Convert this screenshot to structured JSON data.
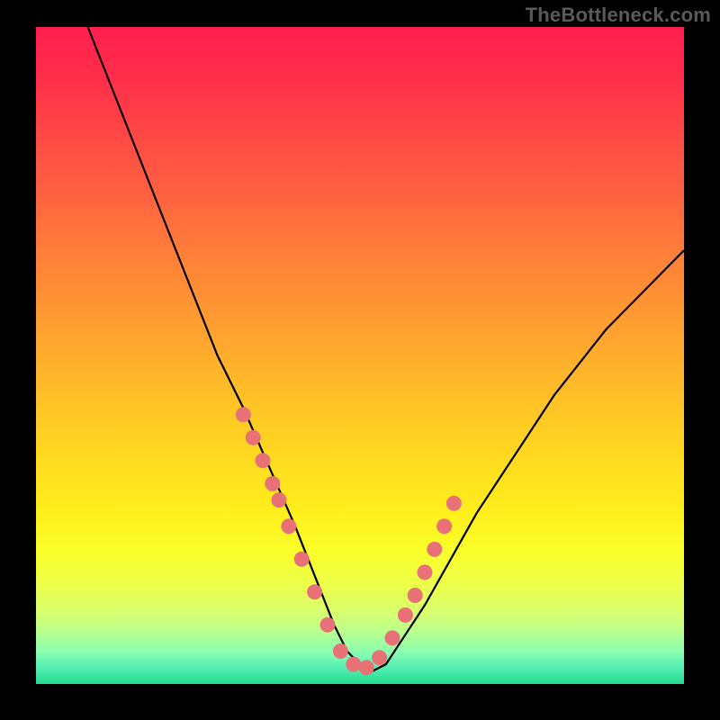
{
  "watermark": "TheBottleneck.com",
  "chart_data": {
    "type": "line",
    "title": "",
    "xlabel": "",
    "ylabel": "",
    "xlim": [
      0,
      100
    ],
    "ylim": [
      0,
      100
    ],
    "series": [
      {
        "name": "bottleneck-curve",
        "x": [
          8,
          12,
          16,
          20,
          24,
          28,
          32,
          36,
          40,
          42,
          44,
          46,
          48,
          50,
          52,
          54,
          56,
          60,
          64,
          68,
          72,
          76,
          80,
          84,
          88,
          92,
          96,
          100
        ],
        "y": [
          100,
          90,
          80,
          70,
          60,
          50,
          42,
          33,
          24,
          19,
          14,
          9,
          5,
          3,
          2,
          3,
          6,
          12,
          19,
          26,
          32,
          38,
          44,
          49,
          54,
          58,
          62,
          66
        ]
      }
    ],
    "markers": {
      "name": "highlight-dots",
      "x": [
        32,
        33.5,
        35,
        36.5,
        37.5,
        39,
        41,
        43,
        45,
        47,
        49,
        51,
        53,
        55,
        57,
        58.5,
        60,
        61.5,
        63,
        64.5
      ],
      "y": [
        41,
        37.5,
        34,
        30.5,
        28,
        24,
        19,
        14,
        9,
        5,
        3,
        2.5,
        4,
        7,
        10.5,
        13.5,
        17,
        20.5,
        24,
        27.5
      ]
    },
    "gradient_stops": [
      {
        "pos": 0,
        "color": "#ff1f4f"
      },
      {
        "pos": 0.25,
        "color": "#ff6040"
      },
      {
        "pos": 0.5,
        "color": "#ffad2d"
      },
      {
        "pos": 0.74,
        "color": "#ffef1d"
      },
      {
        "pos": 0.89,
        "color": "#d8ff6e"
      },
      {
        "pos": 1.0,
        "color": "#23d98e"
      }
    ]
  }
}
